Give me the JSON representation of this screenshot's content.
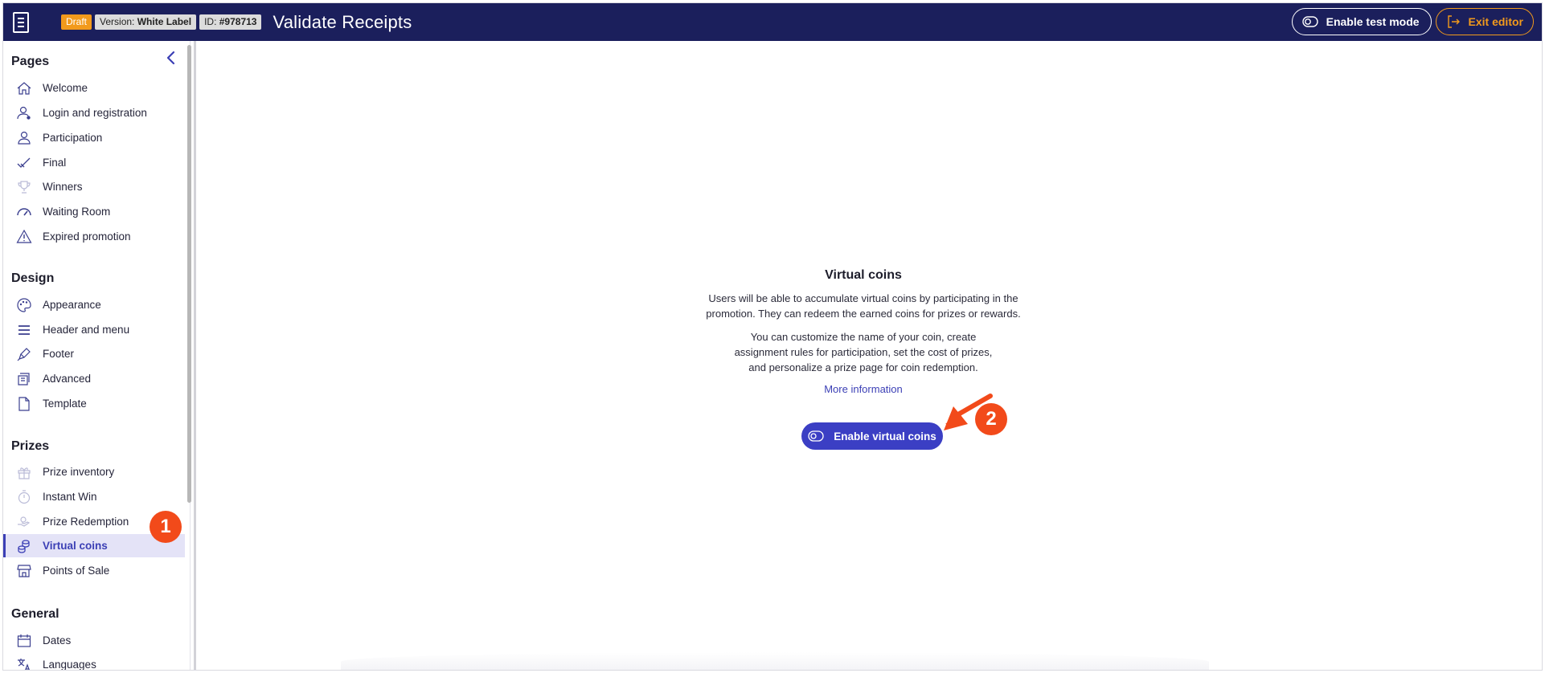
{
  "header": {
    "badges": {
      "draft": "Draft",
      "version_prefix": "Version:",
      "version_value": "White Label",
      "id_prefix": "ID:",
      "id_value": "#978713"
    },
    "title": "Validate Receipts",
    "test_mode_label": "Enable test mode",
    "exit_label": "Exit editor",
    "colors": {
      "bar": "#1b1f5c",
      "accent": "#f29a1c"
    }
  },
  "sidebar": {
    "sections": [
      {
        "title": "Pages",
        "items": [
          {
            "label": "Welcome",
            "icon": "home-icon"
          },
          {
            "label": "Login and registration",
            "icon": "user-login-icon"
          },
          {
            "label": "Participation",
            "icon": "user-participation-icon"
          },
          {
            "label": "Final",
            "icon": "double-check-icon"
          },
          {
            "label": "Winners",
            "icon": "trophy-icon"
          },
          {
            "label": "Waiting Room",
            "icon": "gauge-icon"
          },
          {
            "label": "Expired promotion",
            "icon": "warning-icon"
          }
        ]
      },
      {
        "title": "Design",
        "items": [
          {
            "label": "Appearance",
            "icon": "palette-icon"
          },
          {
            "label": "Header and menu",
            "icon": "menu-lines-icon"
          },
          {
            "label": "Footer",
            "icon": "pen-icon"
          },
          {
            "label": "Advanced",
            "icon": "code-scroll-icon"
          },
          {
            "label": "Template",
            "icon": "document-icon"
          }
        ]
      },
      {
        "title": "Prizes",
        "items": [
          {
            "label": "Prize inventory",
            "icon": "gift-icon"
          },
          {
            "label": "Instant Win",
            "icon": "stopwatch-icon"
          },
          {
            "label": "Prize Redemption",
            "icon": "redemption-icon"
          },
          {
            "label": "Virtual coins",
            "icon": "coins-icon",
            "active": true
          },
          {
            "label": "Points of Sale",
            "icon": "store-icon"
          }
        ]
      },
      {
        "title": "General",
        "items": [
          {
            "label": "Dates",
            "icon": "calendar-icon"
          },
          {
            "label": "Languages",
            "icon": "translate-icon"
          }
        ]
      }
    ]
  },
  "main": {
    "title": "Virtual coins",
    "paragraph1_line1": "Users will be able to accumulate virtual coins by participating in the",
    "paragraph1_line2": "promotion. They can redeem the earned coins for prizes or rewards.",
    "paragraph2_line1": "You can customize the name of your coin, create",
    "paragraph2_line2": "assignment rules for participation, set the cost of prizes,",
    "paragraph2_line3": "and personalize a prize page for coin redemption.",
    "more_info": "More information",
    "enable_button": "Enable virtual coins"
  },
  "annotations": {
    "marker1": "1",
    "marker2": "2",
    "color": "#f24a1a"
  }
}
